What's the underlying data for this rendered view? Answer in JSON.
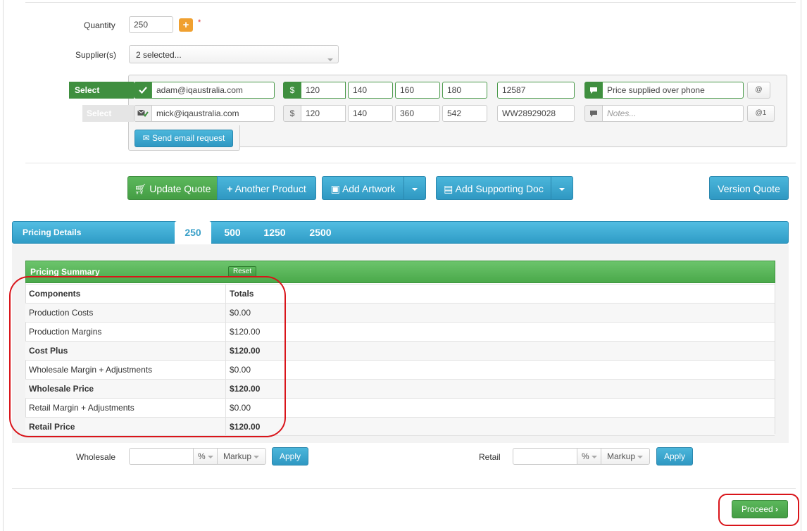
{
  "form": {
    "quantity_label": "Quantity",
    "quantity_value": "250",
    "plus_label": "+",
    "required_mark": "*",
    "suppliers_label": "Supplier(s)",
    "suppliers_value": "2 selected..."
  },
  "suppliers": [
    {
      "select_label": "Select",
      "email": "adam@iqaustralia.com",
      "currency": "$",
      "prices": [
        "120",
        "140",
        "160",
        "180"
      ],
      "ref": "12587",
      "notes": "Price supplied over phone",
      "attach": "@",
      "active": true
    },
    {
      "select_label": "Select",
      "email": "mick@iqaustralia.com",
      "currency": "$",
      "prices": [
        "120",
        "140",
        "360",
        "542"
      ],
      "ref": "WW28929028",
      "notes_placeholder": "Notes...",
      "attach": "@1",
      "active": false
    }
  ],
  "send_email_label": "Send email request",
  "actions": {
    "update_quote": "Update Quote",
    "another_product": "Another Product",
    "add_artwork": "Add Artwork",
    "add_supporting_doc": "Add Supporting Doc",
    "version_quote": "Version Quote"
  },
  "pricing": {
    "title": "Pricing Details",
    "tabs": [
      "250",
      "500",
      "1250",
      "2500"
    ],
    "active_tab": "250"
  },
  "summary": {
    "title": "Pricing Summary",
    "reset_label": "Reset",
    "headers": [
      "Components",
      "Totals"
    ],
    "rows": [
      {
        "component": "Production Costs",
        "total": "$0.00",
        "bold": false
      },
      {
        "component": "Production Margins",
        "total": "$120.00",
        "bold": false
      },
      {
        "component": "Cost Plus",
        "total": "$120.00",
        "bold": true
      },
      {
        "component": "Wholesale Margin + Adjustments",
        "total": "$0.00",
        "bold": false
      },
      {
        "component": "Wholesale Price",
        "total": "$120.00",
        "bold": true
      },
      {
        "component": "Retail Margin + Adjustments",
        "total": "$0.00",
        "bold": false
      },
      {
        "component": "Retail Price",
        "total": "$120.00",
        "bold": true
      }
    ]
  },
  "adjust": {
    "wholesale_label": "Wholesale",
    "retail_label": "Retail",
    "unit": "%",
    "mode": "Markup",
    "apply_label": "Apply"
  },
  "proceed_label": "Proceed",
  "colors": {
    "accent_blue": "#3aa8d0",
    "accent_green": "#5cb85c",
    "annotation_red": "#d9141a"
  }
}
